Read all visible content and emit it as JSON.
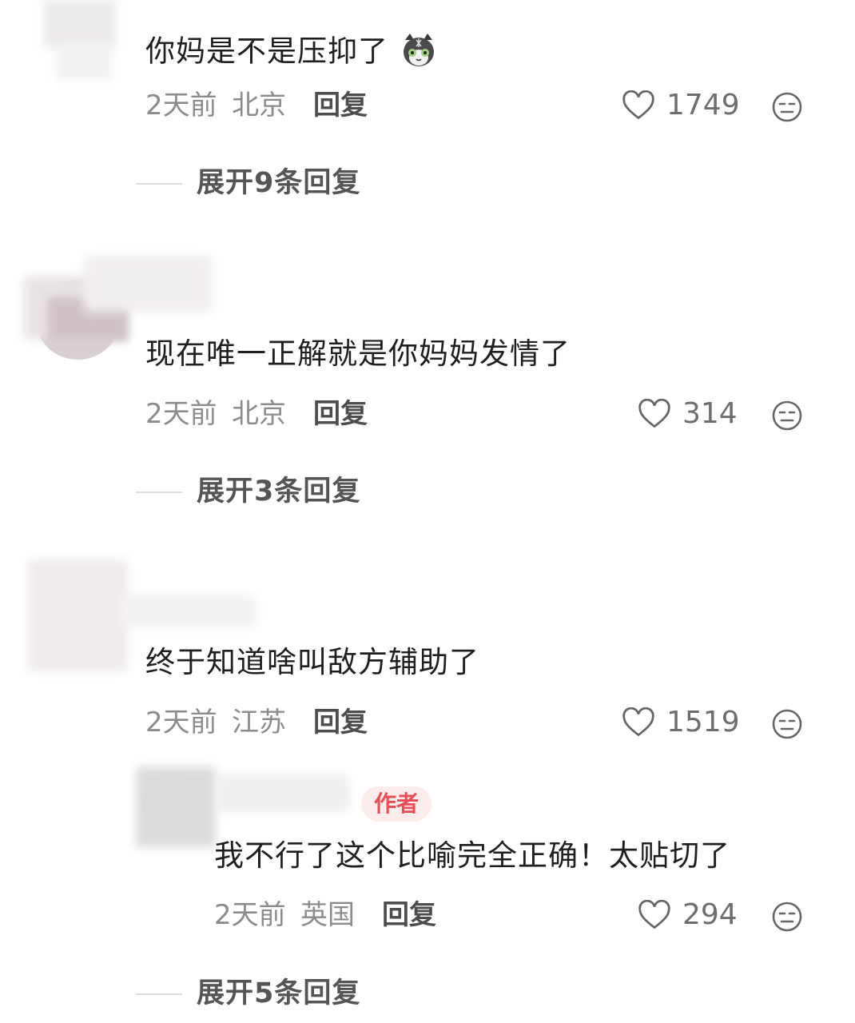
{
  "comments": [
    {
      "text": "你妈是不是压抑了",
      "emoji": "cat-emoji",
      "time": "2天前",
      "location": "北京",
      "reply_label": "回复",
      "likes": "1749",
      "expand_label": "展开9条回复"
    },
    {
      "text": "现在唯一正解就是你妈妈发情了",
      "time": "2天前",
      "location": "北京",
      "reply_label": "回复",
      "likes": "314",
      "expand_label": "展开3条回复"
    },
    {
      "text": "终于知道啥叫敌方辅助了",
      "time": "2天前",
      "location": "江苏",
      "reply_label": "回复",
      "likes": "1519",
      "sub_reply": {
        "author_badge": "作者",
        "text": "我不行了这个比喻完全正确！太贴切了",
        "time": "2天前",
        "location": "英国",
        "reply_label": "回复",
        "likes": "294"
      },
      "expand_label": "展开5条回复"
    }
  ],
  "icons": {
    "like": "heart-outline-icon",
    "dislike": "neutral-face-icon"
  },
  "colors": {
    "text": "#1f1f1f",
    "meta": "#8c8c8c",
    "author_badge_bg": "#fdecec",
    "author_badge_text": "#e94d55"
  }
}
